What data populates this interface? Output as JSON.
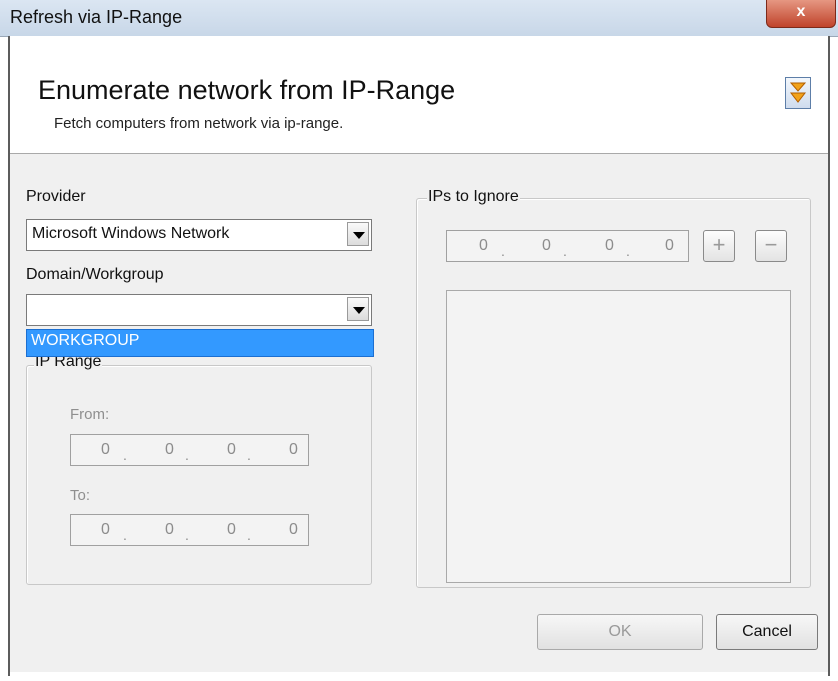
{
  "window": {
    "title": "Refresh via IP-Range",
    "close_glyph": "x"
  },
  "header": {
    "title": "Enumerate network from IP-Range",
    "subtitle": "Fetch computers from network via ip-range.",
    "collapse_icon": "double-chevron-down-icon",
    "accent": "#f2a21a"
  },
  "provider": {
    "label": "Provider",
    "value": "Microsoft Windows Network"
  },
  "domain": {
    "label": "Domain/Workgroup",
    "value": "",
    "dropdown_items": [
      "WORKGROUP"
    ]
  },
  "ip_range": {
    "legend": "IP Range",
    "from_label": "From:",
    "from": [
      "0",
      "0",
      "0",
      "0"
    ],
    "to_label": "To:",
    "to": [
      "0",
      "0",
      "0",
      "0"
    ]
  },
  "ignore": {
    "legend": "IPs to Ignore",
    "ip": [
      "0",
      "0",
      "0",
      "0"
    ],
    "add_glyph": "+",
    "remove_glyph": "−"
  },
  "buttons": {
    "ok": "OK",
    "cancel": "Cancel"
  },
  "colors": {
    "selection": "#3399ff",
    "disabled_text": "#8f8f8f"
  }
}
